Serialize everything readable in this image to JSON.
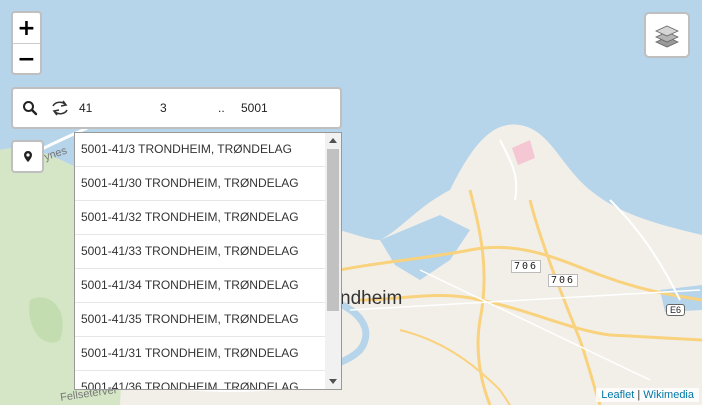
{
  "zoom": {
    "in_label": "+",
    "out_label": "−"
  },
  "search": {
    "fields": [
      "41",
      "3",
      "..",
      "5001"
    ]
  },
  "results": [
    "5001-41/3 TRONDHEIM, TRØNDELAG",
    "5001-41/30 TRONDHEIM, TRØNDELAG",
    "5001-41/32 TRONDHEIM, TRØNDELAG",
    "5001-41/33 TRONDHEIM, TRØNDELAG",
    "5001-41/34 TRONDHEIM, TRØNDELAG",
    "5001-41/35 TRONDHEIM, TRØNDELAG",
    "5001-41/31 TRONDHEIM, TRØNDELAG",
    "5001-41/36 TRONDHEIM, TRØNDELAG"
  ],
  "map_labels": {
    "city": "ndheim",
    "road_706_a": "706",
    "road_706_b": "706",
    "e6": "E6",
    "street_top": "ynes",
    "street_bottom": "Fellsetervei"
  },
  "attribution": {
    "leaflet": "Leaflet",
    "separator": " | ",
    "wikimedia": "Wikimedia"
  },
  "colors": {
    "water": "#b6d4ea",
    "land": "#f2efe9",
    "green": "#d4e6c6",
    "road": "#f9d27e",
    "accent": "#0078a8"
  }
}
